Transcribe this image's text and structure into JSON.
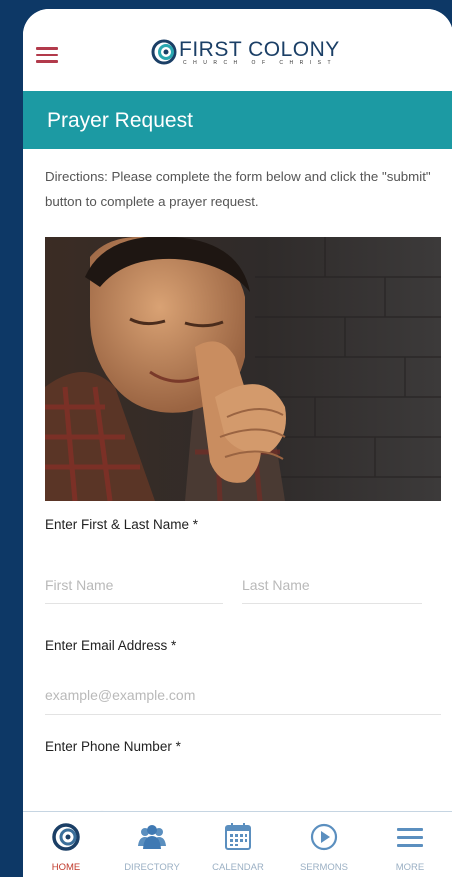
{
  "header": {
    "logo_text": "FIRST COLONY",
    "logo_subtext": "CHURCH OF CHRIST"
  },
  "page": {
    "title": "Prayer Request",
    "directions": "Directions: Please complete the form below and click the \"submit\" button to complete a prayer request."
  },
  "photo": {
    "description_icon": "praying-man-photo"
  },
  "form": {
    "name_label": "Enter First & Last Name *",
    "first_name_placeholder": "First Name",
    "last_name_placeholder": "Last Name",
    "email_label": "Enter Email Address *",
    "email_placeholder": "example@example.com",
    "phone_label": "Enter Phone Number *",
    "phone_mask": "___-___-____"
  },
  "tabbar": {
    "items": [
      {
        "label": "HOME",
        "icon": "home-logo-icon",
        "active": true
      },
      {
        "label": "DIRECTORY",
        "icon": "people-icon",
        "active": false
      },
      {
        "label": "CALENDAR",
        "icon": "calendar-icon",
        "active": false
      },
      {
        "label": "SERMONS",
        "icon": "play-icon",
        "active": false
      },
      {
        "label": "MORE",
        "icon": "menu-icon",
        "active": false
      }
    ]
  },
  "colors": {
    "background": "#0d3866",
    "accent_teal": "#1c9aa3",
    "menu_red": "#b23a4b",
    "tab_inactive": "#9bb0c4",
    "tab_active": "#c0392b"
  }
}
